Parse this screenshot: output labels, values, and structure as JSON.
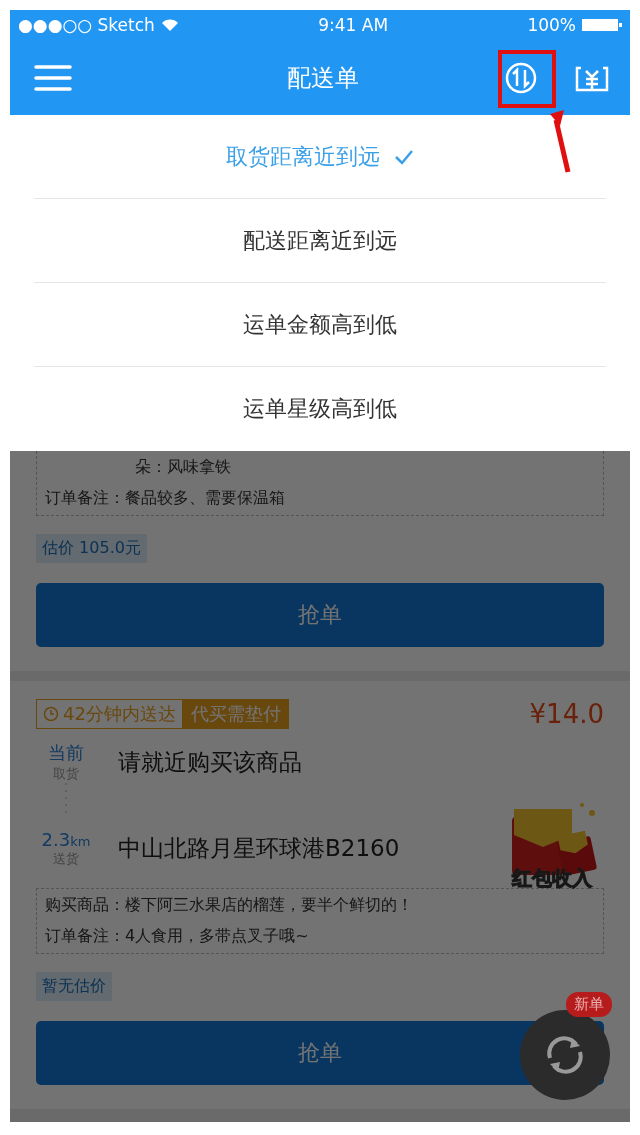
{
  "status_bar": {
    "carrier": "●●●○○ Sketch",
    "time": "9:41 AM",
    "battery": "100%"
  },
  "nav": {
    "title": "配送单"
  },
  "sort_options": [
    {
      "label": "取货距离近到远",
      "selected": true
    },
    {
      "label": "配送距离近到远",
      "selected": false
    },
    {
      "label": "运单金额高到低",
      "selected": false
    },
    {
      "label": "运单星级高到低",
      "selected": false
    }
  ],
  "orders": [
    {
      "partial_line": "朵：风味拿铁",
      "details": [
        {
          "label": "订单备注：",
          "value": "餐品较多、需要保温箱"
        }
      ],
      "estimate": "估价 105.0元",
      "action": "抢单"
    },
    {
      "time_tag": "42分钟内送达",
      "pay_tag": "代买需垫付",
      "price": "¥14.0",
      "stops": [
        {
          "distance": "当前",
          "kind_label": "取货",
          "address": "请就近购买该商品"
        },
        {
          "distance": "2.3",
          "unit": "km",
          "kind_label": "送货",
          "address": "中山北路月星环球港B2160"
        }
      ],
      "red_packet": "红包收入",
      "details": [
        {
          "label": "购买商品：",
          "value": "楼下阿三水果店的榴莲，要半个鲜切的！"
        },
        {
          "label": "订单备注：",
          "value": "4人食用，多带点叉子哦~"
        }
      ],
      "estimate": "暂无估价",
      "action": "抢单"
    }
  ],
  "refresh": {
    "badge": "新单"
  }
}
